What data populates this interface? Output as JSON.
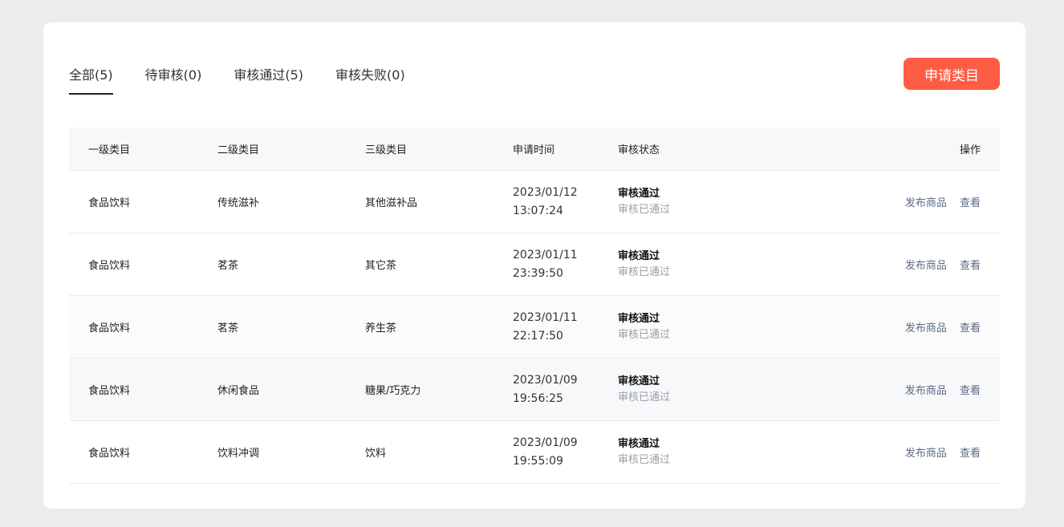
{
  "tabs": [
    {
      "label": "全部(5)",
      "active": true
    },
    {
      "label": "待审核(0)",
      "active": false
    },
    {
      "label": "审核通过(5)",
      "active": false
    },
    {
      "label": "审核失败(0)",
      "active": false
    }
  ],
  "apply_button": "申请类目",
  "table": {
    "headers": [
      "一级类目",
      "二级类目",
      "三级类目",
      "申请时间",
      "审核状态",
      "操作"
    ],
    "rows": [
      {
        "level1": "食品饮料",
        "level2": "传统滋补",
        "level3": "其他滋补品",
        "date": "2023/01/12",
        "time": "13:07:24",
        "status": "审核通过",
        "status_sub": "审核已通过",
        "op_publish": "发布商品",
        "op_view": "查看"
      },
      {
        "level1": "食品饮料",
        "level2": "茗茶",
        "level3": "其它茶",
        "date": "2023/01/11",
        "time": "23:39:50",
        "status": "审核通过",
        "status_sub": "审核已通过",
        "op_publish": "发布商品",
        "op_view": "查看"
      },
      {
        "level1": "食品饮料",
        "level2": "茗茶",
        "level3": "养生茶",
        "date": "2023/01/11",
        "time": "22:17:50",
        "status": "审核通过",
        "status_sub": "审核已通过",
        "op_publish": "发布商品",
        "op_view": "查看"
      },
      {
        "level1": "食品饮料",
        "level2": "休闲食品",
        "level3": "糖果/巧克力",
        "date": "2023/01/09",
        "time": "19:56:25",
        "status": "审核通过",
        "status_sub": "审核已通过",
        "op_publish": "发布商品",
        "op_view": "查看"
      },
      {
        "level1": "食品饮料",
        "level2": "饮料冲调",
        "level3": "饮料",
        "date": "2023/01/09",
        "time": "19:55:09",
        "status": "审核通过",
        "status_sub": "审核已通过",
        "op_publish": "发布商品",
        "op_view": "查看"
      }
    ]
  },
  "colors": {
    "accent": "#fe5d43",
    "link": "#5a6a85",
    "muted": "#9aa0a8"
  }
}
